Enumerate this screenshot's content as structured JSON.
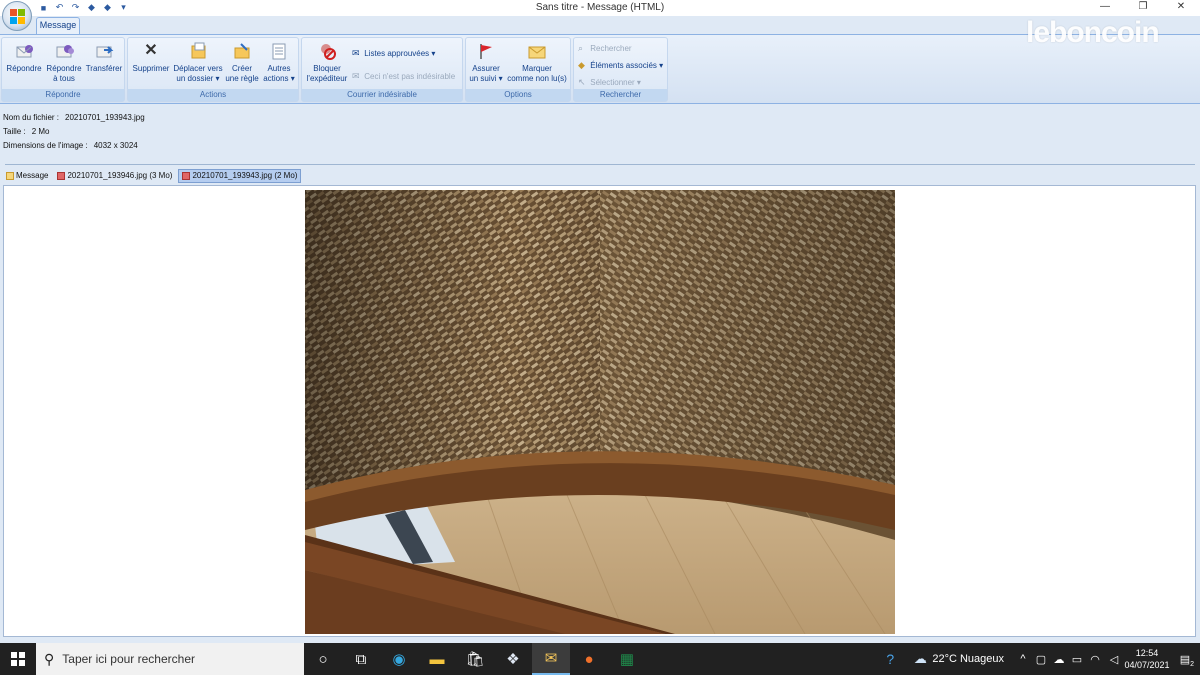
{
  "window": {
    "title": "Sans titre - Message (HTML)",
    "watermark": "leboncoin",
    "controls": [
      "—",
      "❐",
      "✕"
    ]
  },
  "ribbon": {
    "tab": "Message",
    "groups": {
      "repondre": {
        "label": "Répondre",
        "buttons": [
          {
            "l1": "Répondre",
            "l2": ""
          },
          {
            "l1": "Répondre",
            "l2": "à tous"
          },
          {
            "l1": "Transférer",
            "l2": ""
          }
        ]
      },
      "actions": {
        "label": "Actions",
        "buttons": [
          {
            "l1": "Supprimer",
            "l2": ""
          },
          {
            "l1": "Déplacer vers",
            "l2": "un dossier ▾"
          },
          {
            "l1": "Créer",
            "l2": "une règle"
          },
          {
            "l1": "Autres",
            "l2": "actions ▾"
          }
        ]
      },
      "courrier": {
        "label": "Courrier indésirable",
        "bloquer_l1": "Bloquer",
        "bloquer_l2": "l'expéditeur",
        "listes": "Listes approuvées ▾",
        "pas_indesirable": "Ceci n'est pas indésirable"
      },
      "options": {
        "label": "Options",
        "suivi_l1": "Assurer",
        "suivi_l2": "un suivi ▾",
        "marquer_l1": "Marquer",
        "marquer_l2": "comme non lu(s)"
      },
      "rechercher": {
        "label": "Rechercher",
        "rechercher": "Rechercher",
        "elements": "Éléments associés ▾",
        "selectionner": "Sélectionner ▾"
      }
    }
  },
  "attachment_info": {
    "filename_label": "Nom du fichier :",
    "filename": "20210701_193943.jpg",
    "size_label": "Taille :",
    "size": "2 Mo",
    "dims_label": "Dimensions de l'image :",
    "dims": "4032 x 3024"
  },
  "attachment_tabs": [
    {
      "label": "Message"
    },
    {
      "label": "20210701_193946.jpg (3 Mo)"
    },
    {
      "label": "20210701_193943.jpg (2 Mo)"
    }
  ],
  "taskbar": {
    "search_placeholder": "Taper ici pour rechercher",
    "weather": "22°C  Nuageux",
    "time": "12:54",
    "date": "04/07/2021",
    "notif_count": "2"
  }
}
